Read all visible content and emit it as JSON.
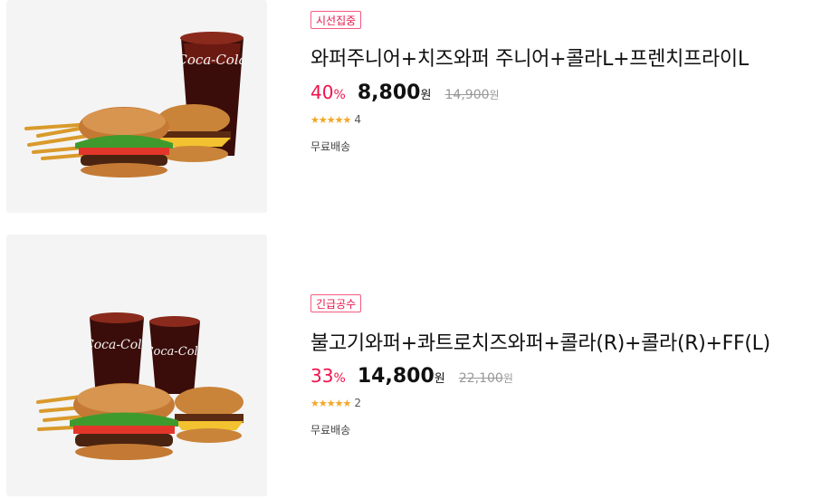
{
  "products": [
    {
      "badge": "시선집중",
      "title": "와퍼주니어+치즈와퍼 주니어+콜라L+프렌치프라이L",
      "discount": "40",
      "discount_unit": "%",
      "price": "8,800",
      "price_unit": "원",
      "original_price": "14,900",
      "original_unit": "원",
      "stars": "★★★★★",
      "rating_fraction": 1.0,
      "review_count": "4",
      "shipping": "무료배송",
      "image_logo_text": "Coca-Cola"
    },
    {
      "badge": "긴급공수",
      "title": "불고기와퍼+콰트로치즈와퍼+콜라(R)+콜라(R)+FF(L)",
      "discount": "33",
      "discount_unit": "%",
      "price": "14,800",
      "price_unit": "원",
      "original_price": "22,100",
      "original_unit": "원",
      "stars": "★★★★★",
      "rating_fraction": 1.0,
      "review_count": "2",
      "shipping": "무료배송",
      "image_logo_text": "Coca-Cola"
    }
  ],
  "colors": {
    "accent": "#f0124c",
    "badge_border": "#f45b7e",
    "star": "#f5a623",
    "thumb_bg": "#f4f4f4"
  }
}
